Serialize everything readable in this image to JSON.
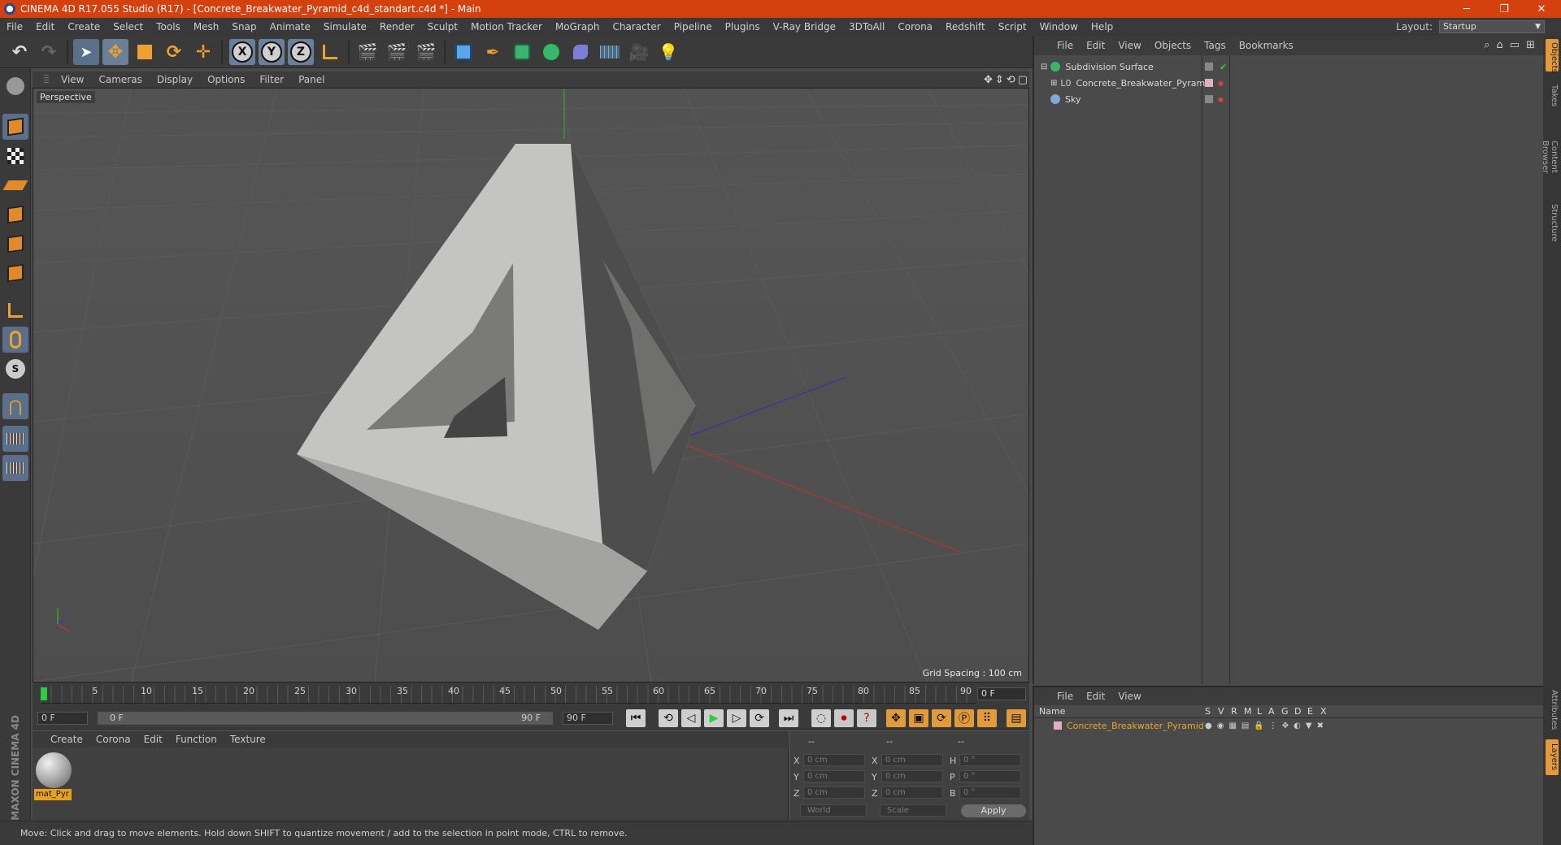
{
  "window": {
    "title": "CINEMA 4D R17.055 Studio (R17) - [Concrete_Breakwater_Pyramid_c4d_standart.c4d *] - Main",
    "minimize": "─",
    "restore": "❐",
    "close": "✕"
  },
  "menu": [
    "File",
    "Edit",
    "Create",
    "Select",
    "Tools",
    "Mesh",
    "Snap",
    "Animate",
    "Simulate",
    "Render",
    "Sculpt",
    "Motion Tracker",
    "MoGraph",
    "Character",
    "Pipeline",
    "Plugins",
    "V-Ray Bridge",
    "3DToAll",
    "Corona",
    "Redshift",
    "Script",
    "Window",
    "Help"
  ],
  "layout": {
    "label": "Layout:",
    "value": "Startup"
  },
  "toolbar": {
    "x": "X",
    "y": "Y",
    "z": "Z"
  },
  "viewport": {
    "menu": [
      "View",
      "Cameras",
      "Display",
      "Options",
      "Filter",
      "Panel"
    ],
    "label": "Perspective",
    "grid_spacing": "Grid Spacing : 100 cm"
  },
  "timeline": {
    "ticks": [
      "0",
      "5",
      "10",
      "15",
      "20",
      "25",
      "30",
      "35",
      "40",
      "45",
      "50",
      "55",
      "60",
      "65",
      "70",
      "75",
      "80",
      "85",
      "90"
    ],
    "current": "0 F",
    "start": "0 F",
    "range_start": "0 F",
    "range_end": "90 F",
    "end": "90 F"
  },
  "material": {
    "menu": [
      "Create",
      "Corona",
      "Edit",
      "Function",
      "Texture"
    ],
    "name": "mat_Pyr"
  },
  "coords": {
    "head": [
      "--",
      "--",
      "--"
    ],
    "rows": [
      {
        "a": "X",
        "av": "0 cm",
        "b": "X",
        "bv": "0 cm",
        "c": "H",
        "cv": "0 °"
      },
      {
        "a": "Y",
        "av": "0 cm",
        "b": "Y",
        "bv": "0 cm",
        "c": "P",
        "cv": "0 °"
      },
      {
        "a": "Z",
        "av": "0 cm",
        "b": "Z",
        "bv": "0 cm",
        "c": "B",
        "cv": "0 °"
      }
    ],
    "space": "World",
    "mode": "Scale",
    "apply": "Apply"
  },
  "status": "Move: Click and drag to move elements. Hold down SHIFT to quantize movement / add to the selection in point mode, CTRL to remove.",
  "objects": {
    "menu": [
      "File",
      "Edit",
      "View",
      "Objects",
      "Tags",
      "Bookmarks"
    ],
    "items": [
      {
        "name": "Subdivision Surface",
        "color": "#3cb371"
      },
      {
        "name": "Concrete_Breakwater_Pyramid",
        "color": "#bbbbbb"
      },
      {
        "name": "Sky",
        "color": "#7fa7d8"
      }
    ]
  },
  "layers": {
    "menu": [
      "File",
      "Edit",
      "View"
    ],
    "cols": [
      "Name",
      "S",
      "V",
      "R",
      "M",
      "L",
      "A",
      "G",
      "D",
      "E",
      "X"
    ],
    "row": "Concrete_Breakwater_Pyramid"
  },
  "sidetabs": [
    "Objects",
    "Takes",
    "Content Browser",
    "Structure",
    "Attributes",
    "Layers"
  ],
  "brand": "MAXON CINEMA 4D"
}
